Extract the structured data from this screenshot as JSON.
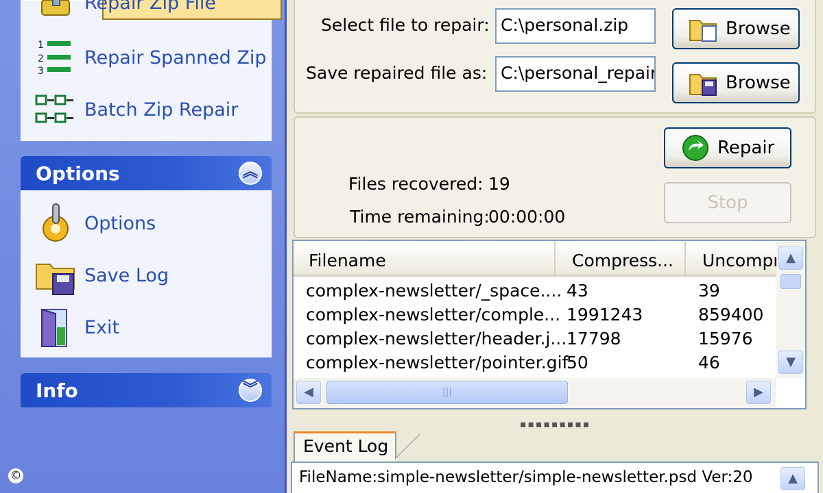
{
  "sidebar": {
    "tasks": [
      {
        "label": "Repair Zip File",
        "icon": "repair-zip-icon"
      },
      {
        "label": "Repair Spanned Zip",
        "icon": "spanned-zip-icon"
      },
      {
        "label": "Batch Zip Repair",
        "icon": "batch-repair-icon"
      }
    ],
    "options": {
      "title": "Options",
      "items": [
        {
          "label": "Options",
          "icon": "options-icon"
        },
        {
          "label": "Save Log",
          "icon": "save-log-icon"
        },
        {
          "label": "Exit",
          "icon": "exit-icon"
        }
      ]
    },
    "info": {
      "title": "Info"
    }
  },
  "copyright": "©",
  "files": {
    "select_label": "Select file to repair:",
    "select_value": "C:\\personal.zip",
    "save_label": "Save repaired file as:",
    "save_value": "C:\\personal_repair",
    "browse_label": "Browse"
  },
  "repair": {
    "progress_fraction": 1.0,
    "files_recovered_label": "Files recovered:",
    "files_recovered_value": "19",
    "time_remaining_label": "Time remaining:",
    "time_remaining_value": "00:00:00",
    "repair_label": "Repair",
    "stop_label": "Stop"
  },
  "table": {
    "columns": [
      "Filename",
      "Compress...",
      "Uncompr"
    ],
    "rows": [
      [
        "complex-newsletter/_space....",
        "43",
        "39"
      ],
      [
        "complex-newsletter/comple...",
        "1991243",
        "859400"
      ],
      [
        "complex-newsletter/header.j...",
        "17798",
        "15976"
      ],
      [
        "complex-newsletter/pointer.gif",
        "50",
        "46"
      ]
    ]
  },
  "event_log": {
    "tab_label": "Event Log",
    "line1": "FileName:simple-newsletter/simple-newsletter.psd Ver:20"
  },
  "colors": {
    "sidebar_bg": "#6f86dc",
    "panel_header": "#1f4cc6",
    "progress": "#2ebb2e"
  }
}
